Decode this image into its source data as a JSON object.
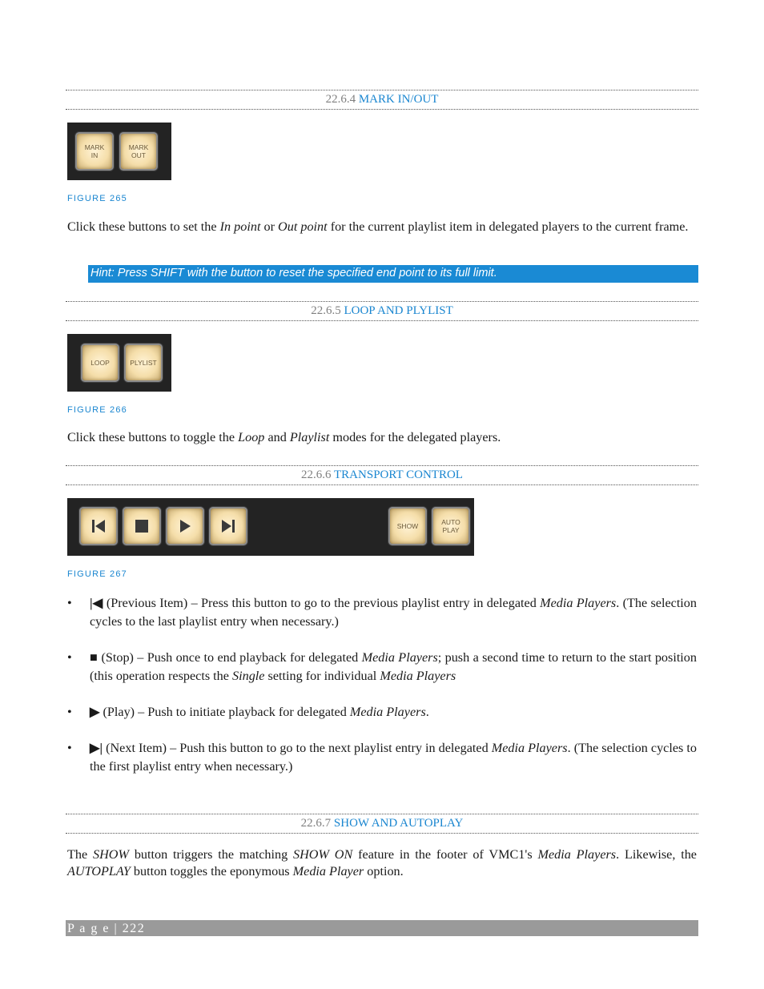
{
  "sections": [
    {
      "number": "22.6.4",
      "title": "MARK IN/OUT"
    },
    {
      "number": "22.6.5",
      "title": "LOOP AND PLYLIST"
    },
    {
      "number": "22.6.6",
      "title": "TRANSPORT CONTROL"
    },
    {
      "number": "22.6.7",
      "title": "SHOW AND AUTOPLAY"
    }
  ],
  "figures": {
    "fig265": {
      "caption": "FIGURE 265",
      "buttons": [
        {
          "line1": "MARK",
          "line2": "IN"
        },
        {
          "line1": "MARK",
          "line2": "OUT"
        }
      ]
    },
    "fig266": {
      "caption": "FIGURE 266",
      "buttons": [
        {
          "label": "LOOP"
        },
        {
          "label": "PLYLIST"
        }
      ]
    },
    "fig267": {
      "caption": "FIGURE 267",
      "transport_icons": [
        "previous-item-icon",
        "stop-icon",
        "play-icon",
        "next-item-icon"
      ],
      "buttons": [
        {
          "label": "SHOW"
        },
        {
          "line1": "AUTO",
          "line2": "PLAY"
        }
      ]
    }
  },
  "mark_in_out": {
    "p1": "Click these buttons to set the ",
    "in_point": "In point",
    "p2": " or ",
    "out_point": "Out point",
    "p3": " for the current playlist item in delegated players to the current frame.",
    "hint": "Hint: Press SHIFT with the button to reset the specified end point to its full limit."
  },
  "loop_playlist": {
    "p1": "Click these buttons to toggle the ",
    "loop": "Loop",
    "p2": " and ",
    "playlist": "Playlist",
    "p3": " modes for the delegated players."
  },
  "transport": {
    "bullets": [
      {
        "symbol": "|◀",
        "a": " (Previous Item) – Press this button to go to the previous playlist entry in delegated ",
        "em": "Media Players",
        "b": ". (The selection cycles to the last playlist entry when necessary.)"
      },
      {
        "symbol": "■",
        "a": " (Stop) – Push once to end playback for delegated ",
        "em": "Media Players",
        "b": "; push a second time to return to the start position (this operation respects the ",
        "em2": "Single",
        "c": " setting for individual ",
        "em3": "Media Players"
      },
      {
        "symbol": "▶",
        "a": " (Play) – Push to initiate playback for delegated ",
        "em": "Media Players",
        "b": "."
      },
      {
        "symbol": "▶|",
        "a": " (Next Item) – Push this button to go to the next playlist entry in delegated ",
        "em": "Media Players",
        "b": ". (The selection cycles to the first playlist entry when necessary.)"
      }
    ]
  },
  "show_autoplay": {
    "a": "The ",
    "show": "SHOW",
    "b": " button triggers the matching ",
    "show_on": "SHOW ON",
    "c": " feature in the footer of VMC1's ",
    "media_players": "Media Players",
    "d": ". Likewise, the ",
    "autoplay": "AUTOPLAY",
    "e": " button toggles the eponymous ",
    "media_player": "Media Player",
    "f": " option."
  },
  "footer": {
    "label": "P a g e",
    "separator": "|",
    "page": "222"
  }
}
